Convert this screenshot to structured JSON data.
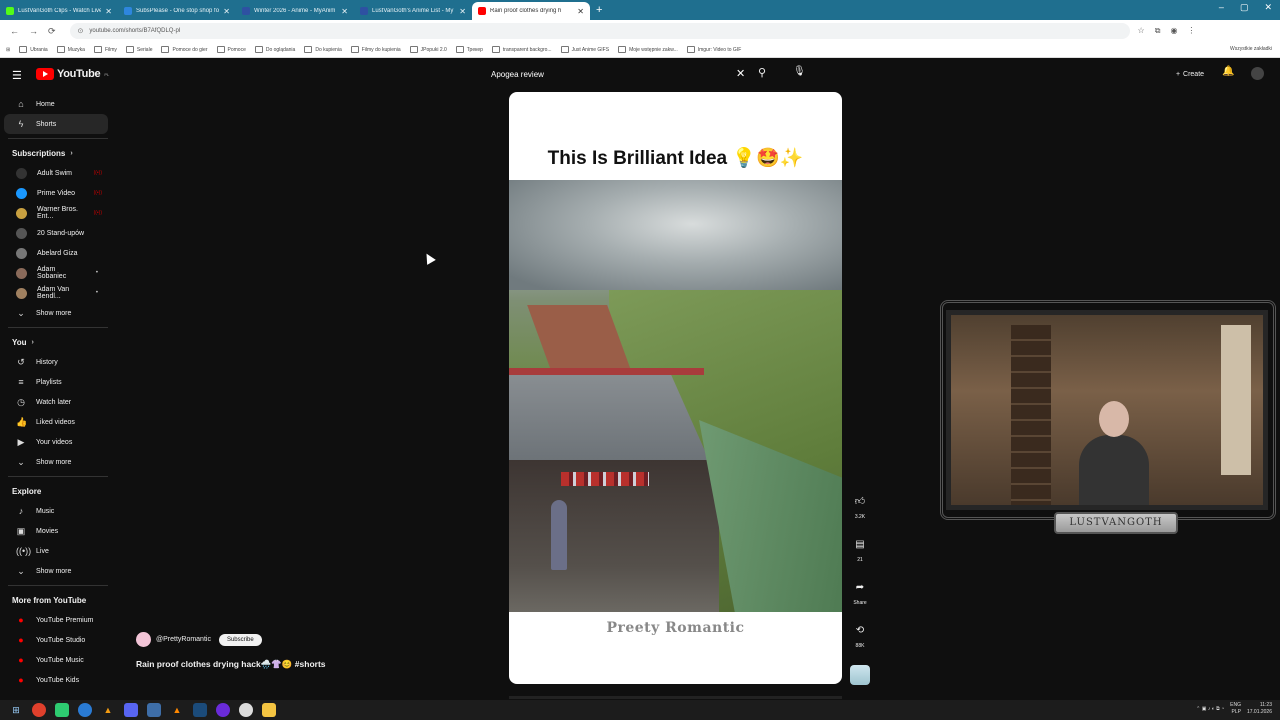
{
  "browser": {
    "tabs": [
      {
        "title": "LustVanGoth Clips - Watch Live",
        "color": "#53fc18",
        "active": false
      },
      {
        "title": "SubsPlease - One stop shop fo",
        "color": "#2e86de",
        "active": false
      },
      {
        "title": "Winter 2026 - Anime - MyAnim",
        "color": "#2e51a2",
        "active": false
      },
      {
        "title": "LustVanGoth's Anime List - My",
        "color": "#2e51a2",
        "active": false
      },
      {
        "title": "Rain proof clothes drying h",
        "color": "#ff0000",
        "active": true
      }
    ],
    "new_tab": "+",
    "url": "youtube.com/shorts/B7AfQDLQ-pI",
    "bookmarks": [
      "Ubrania",
      "Muzyka",
      "Filmy",
      "Seriale",
      "Pomoce do gier",
      "Pomoce",
      "Do oglądania",
      "Do kupienia",
      "Filmy do kupienia",
      "JPopuki 2.0",
      "Трекер",
      "transparent backgro...",
      "Just Anime GIFS",
      "Moje wstępnie zakw...",
      "Imgur: Video to GIF"
    ],
    "bookmarks_all": "Wszystkie zakładki"
  },
  "youtube": {
    "logo": "YouTube",
    "region": "PL",
    "search_query": "Apogea review",
    "create_label": "Create"
  },
  "sidebar": {
    "main": [
      {
        "label": "Home",
        "icon": "⌂"
      },
      {
        "label": "Shorts",
        "icon": "ϟ"
      }
    ],
    "subscriptions_title": "Subscriptions",
    "subscriptions": [
      {
        "label": "Adult Swim",
        "color": "#333",
        "badge": "((•))"
      },
      {
        "label": "Prime Video",
        "color": "#1a98ff",
        "badge": "((•))"
      },
      {
        "label": "Warner Bros. Ent...",
        "color": "#c8a040",
        "badge": "((•))"
      },
      {
        "label": "20 Stand-upów",
        "color": "#555",
        "badge": ""
      },
      {
        "label": "Abelard Giza",
        "color": "#777",
        "badge": ""
      },
      {
        "label": "Adam Sobaniec",
        "color": "#8a6a5a",
        "badge": "•"
      },
      {
        "label": "Adam Van Bendl...",
        "color": "#a08060",
        "badge": "•"
      }
    ],
    "show_more": "Show more",
    "you_title": "You",
    "you": [
      {
        "label": "History",
        "icon": "↺"
      },
      {
        "label": "Playlists",
        "icon": "≡"
      },
      {
        "label": "Watch later",
        "icon": "◷"
      },
      {
        "label": "Liked videos",
        "icon": "👍"
      },
      {
        "label": "Your videos",
        "icon": "▶"
      }
    ],
    "explore_title": "Explore",
    "explore": [
      {
        "label": "Music",
        "icon": "♪"
      },
      {
        "label": "Movies",
        "icon": "▣"
      },
      {
        "label": "Live",
        "icon": "((•))"
      }
    ],
    "more_title": "More from YouTube",
    "more": [
      {
        "label": "YouTube Premium"
      },
      {
        "label": "YouTube Studio"
      },
      {
        "label": "YouTube Music"
      },
      {
        "label": "YouTube Kids"
      }
    ]
  },
  "short": {
    "overlay_title": "This Is Brilliant Idea 💡🤩✨",
    "watermark": "Preety Romantic",
    "channel": "@PrettyRomantic",
    "subscribe": "Subscribe",
    "video_title": "Rain proof clothes drying hack🌧️👚😊 #shorts",
    "likes": "3.2K",
    "comments": "21",
    "share": "Share",
    "remix": "88K"
  },
  "stream": {
    "banner": "LUSTVANGOTH"
  },
  "taskbar": {
    "lang": "ENG",
    "lang2": "PLP",
    "time": "11:23",
    "date": "17.01.2026"
  }
}
